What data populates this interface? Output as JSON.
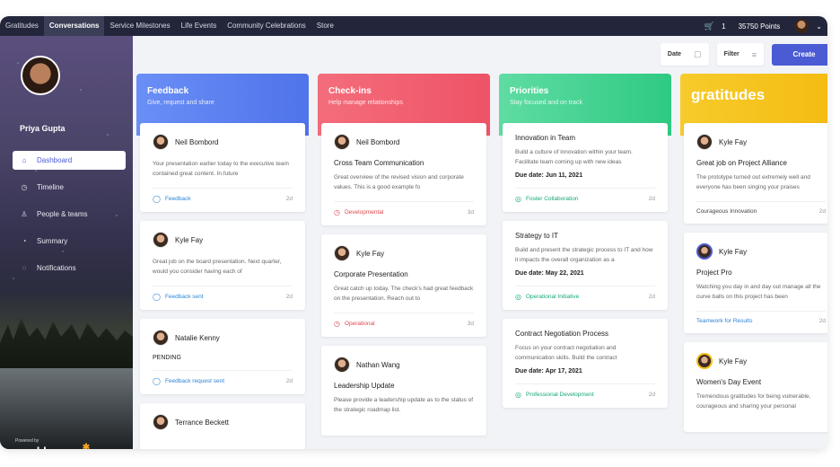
{
  "nav": {
    "items": [
      "Gratitudes",
      "Conversations",
      "Service Milestones",
      "Life Events",
      "Community Celebrations",
      "Store"
    ],
    "active": "Conversations",
    "cart_count": "1",
    "points": "35750 Points"
  },
  "sidebar": {
    "name": "Priya Gupta",
    "menu": [
      {
        "label": "Dashboard",
        "icon": "home-icon"
      },
      {
        "label": "Timeline",
        "icon": "clock-icon"
      },
      {
        "label": "People & teams",
        "icon": "people-icon"
      },
      {
        "label": "Summary",
        "icon": "chart-icon"
      },
      {
        "label": "Notifications",
        "icon": "bell-icon"
      }
    ],
    "powered_by": "Powered by",
    "brand": "workhuman"
  },
  "toolbar": {
    "date_label": "Date",
    "filter_label": "Filter",
    "create_label": "Create"
  },
  "colors": {
    "feedback": "#5b82f0",
    "checkins": "#f05b6c",
    "priorities": "#3fd08f",
    "gratitudes": "#f5c218",
    "accent": "#4a5bd4"
  },
  "columns": {
    "feedback": {
      "title": "Feedback",
      "subtitle": "Give, request and share",
      "cards": [
        {
          "name": "Neil Bombord",
          "text": "Your presentation earlier today to the executive team contained great content. In future",
          "tag": "Feedback",
          "age": "2d"
        },
        {
          "name": "Kyle Fay",
          "text": "Great job on the board presentation. Next quarter, would you consider having each of",
          "tag": "Feedback sent",
          "age": "2d"
        },
        {
          "name": "Natalie Kenny",
          "status": "PENDING",
          "tag": "Feedback request sent",
          "age": "2d"
        },
        {
          "name": "Terrance Beckett"
        }
      ]
    },
    "checkins": {
      "title": "Check-ins",
      "subtitle": "Help manage relationships",
      "cards": [
        {
          "name": "Neil Bombord",
          "title": "Cross Team Communication",
          "text": "Great overview of the revised vision and corporate values. This is a good example fo",
          "tag": "Developmental",
          "age": "3d"
        },
        {
          "name": "Kyle Fay",
          "title": "Corporate Presentation",
          "text": "Great catch up today. The check's had great feedback on the presentation. Reach out to",
          "tag": "Operational",
          "age": "3d"
        },
        {
          "name": "Nathan Wang",
          "title": "Leadership Update",
          "text": "Please provide a leadership update as to the status of the strategic roadmap list."
        }
      ]
    },
    "priorities": {
      "title": "Priorities",
      "subtitle": "Stay focused and on track",
      "cards": [
        {
          "title": "Innovation in Team",
          "text": "Build a culture of innovation within your team. Facilitate team coming up with new ideas",
          "due": "Due date: Jun 11, 2021",
          "tag": "Foster Collaboration",
          "age": "2d"
        },
        {
          "title": "Strategy to IT",
          "text": "Build and present the strategic process to IT and how it impacts the overall organization as a",
          "due": "Due date: May 22, 2021",
          "tag": "Operational Initiative",
          "age": "2d"
        },
        {
          "title": "Contract Negotiation Process",
          "text": "Focus on your contract negotiation and communication skills. Build the contract",
          "due": "Due date: Apr 17, 2021",
          "tag": "Professional Development",
          "age": "2d"
        }
      ]
    },
    "gratitudes": {
      "title": "gratitudes",
      "cards": [
        {
          "name": "Kyle Fay",
          "title": "Great job on Project Alliance",
          "text": "The prototype turned out extremely well and everyone has been singing your praises",
          "tag": "Courageous Innovation",
          "age": "2d"
        },
        {
          "name": "Kyle Fay",
          "title": "Project Pro",
          "text": "Watching you day in and day out manage all the curve balls on this project has been",
          "tag": "Teamwork for Results",
          "age": "2d"
        },
        {
          "name": "Kyle Fay",
          "title": "Women's Day Event",
          "text": "Tremendous gratitudes for being vulnerable, courageous and sharing your personal"
        }
      ]
    }
  }
}
